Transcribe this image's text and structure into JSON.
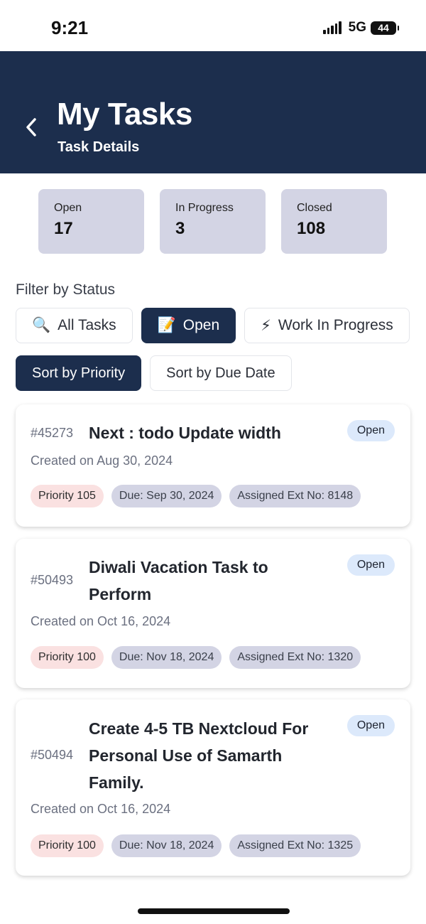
{
  "status_bar": {
    "time": "9:21",
    "network": "5G",
    "battery": "44"
  },
  "header": {
    "title": "My Tasks",
    "subtitle": "Task Details"
  },
  "stats": [
    {
      "label": "Open",
      "value": "17"
    },
    {
      "label": "In Progress",
      "value": "3"
    },
    {
      "label": "Closed",
      "value": "108"
    }
  ],
  "filter": {
    "title": "Filter by Status",
    "chips": [
      {
        "emoji": "🔍",
        "label": "All Tasks",
        "active": false
      },
      {
        "emoji": "📝",
        "label": "Open",
        "active": true
      },
      {
        "emoji": "⚡",
        "label": "Work In Progress",
        "active": false
      }
    ]
  },
  "sort": {
    "priority_label": "Sort by Priority",
    "due_label": "Sort by Due Date",
    "active": "priority"
  },
  "tasks": [
    {
      "id": "#45273",
      "title_lines": [
        "Next : todo Update width"
      ],
      "status": "Open",
      "created": "Created on Aug 30, 2024",
      "priority": "Priority 105",
      "due": "Due: Sep 30, 2024",
      "assigned": "Assigned Ext No: 8148"
    },
    {
      "id": "#50493",
      "title_lines": [
        "Diwali Vacation Task to",
        "Perform"
      ],
      "status": "Open",
      "created": "Created on Oct 16, 2024",
      "priority": "Priority 100",
      "due": "Due: Nov 18, 2024",
      "assigned": "Assigned Ext No: 1320"
    },
    {
      "id": "#50494",
      "title_lines": [
        "Create 4-5 TB Nextcloud For",
        "Personal Use of Samarth",
        "Family."
      ],
      "status": "Open",
      "created": "Created on Oct 16, 2024",
      "priority": "Priority 100",
      "due": "Due: Nov 18, 2024",
      "assigned": "Assigned Ext No: 1325"
    }
  ],
  "colors": {
    "header_bg": "#1c2e4d",
    "stat_bg": "#d3d4e4",
    "badge_bg": "#dce9fb",
    "priority_bg": "#fae1e1"
  }
}
